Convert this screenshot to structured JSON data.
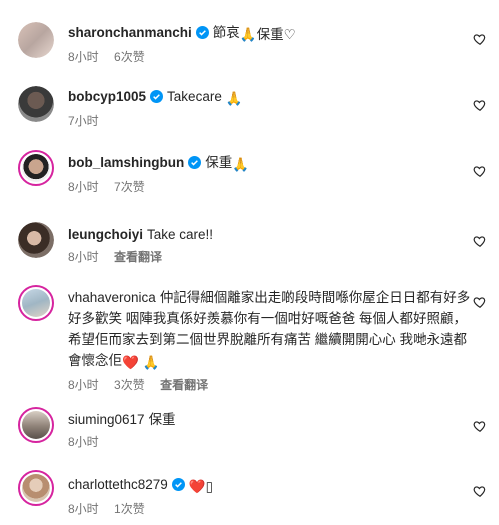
{
  "comments": [
    {
      "username": "sharonchanmanchi",
      "verified": true,
      "text": "節哀",
      "emoji_after": "🙏保重♡",
      "time": "8小时",
      "likes": "6次赞",
      "translate": ""
    },
    {
      "username": "bobcyp1005",
      "verified": true,
      "text": "Takecare",
      "emoji_after": "🙏",
      "time": "7小时",
      "likes": "",
      "translate": ""
    },
    {
      "username": "bob_lamshingbun",
      "verified": true,
      "text": "保重",
      "emoji_after": "🙏",
      "time": "8小时",
      "likes": "7次赞",
      "translate": ""
    },
    {
      "username": "leungchoiyi",
      "verified": false,
      "text": "Take care!!",
      "emoji_after": "",
      "time": "8小时",
      "likes": "",
      "translate": "查看翻译"
    },
    {
      "username": "vhahaveronica",
      "verified": false,
      "text": "仲記得細個離家出走啲段時間喺你屋企日日都有好多好多歡笑 咽陣我真係好羨慕你有一個咁好嘅爸爸 每個人都好照顧，希望佢而家去到第二個世界脫離所有痛苦 繼續開開心心 我哋永遠都會懷念佢",
      "emoji_after": "❤️ 🙏",
      "time": "8小时",
      "likes": "3次赞",
      "translate": "查看翻译"
    },
    {
      "username": "siuming0617",
      "verified": false,
      "text": "保重",
      "emoji_after": "",
      "time": "8小时",
      "likes": "",
      "translate": ""
    },
    {
      "username": "charlottethc8279",
      "verified": true,
      "text": "",
      "emoji_after": "❤️▯",
      "time": "8小时",
      "likes": "1次赞",
      "translate": ""
    }
  ],
  "colors": {
    "verified": "#0095f6",
    "story_ring": "#d6249f",
    "meta": "#737373",
    "heart": "#ed4956"
  }
}
